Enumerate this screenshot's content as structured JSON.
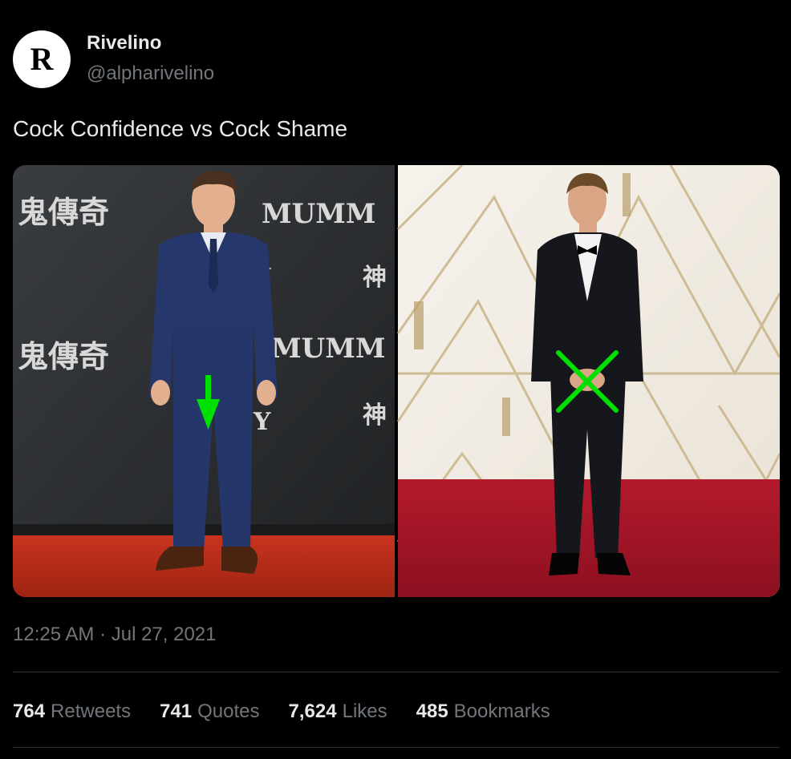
{
  "author": {
    "name": "Rivelino",
    "handle": "@alpharivelino",
    "avatar_letter": "R"
  },
  "tweet": {
    "text": "Cock Confidence vs Cock Shame",
    "timestamp": "12:25 AM · Jul 27, 2021"
  },
  "media": {
    "left_photo": {
      "subject": "man in navy suit on red carpet with green down arrow",
      "backdrop_text": [
        "鬼傳奇",
        "MUMM",
        "Y",
        "神"
      ]
    },
    "right_photo": {
      "subject": "man in black tuxedo on red carpet with green X over hands"
    }
  },
  "stats": [
    {
      "count": "764",
      "label": "Retweets"
    },
    {
      "count": "741",
      "label": "Quotes"
    },
    {
      "count": "7,624",
      "label": "Likes"
    },
    {
      "count": "485",
      "label": "Bookmarks"
    }
  ],
  "colors": {
    "background": "#000000",
    "primary_text": "#e7e9ea",
    "secondary_text": "#71767b",
    "divider": "#2f3336",
    "annotation_green": "#00e000"
  }
}
